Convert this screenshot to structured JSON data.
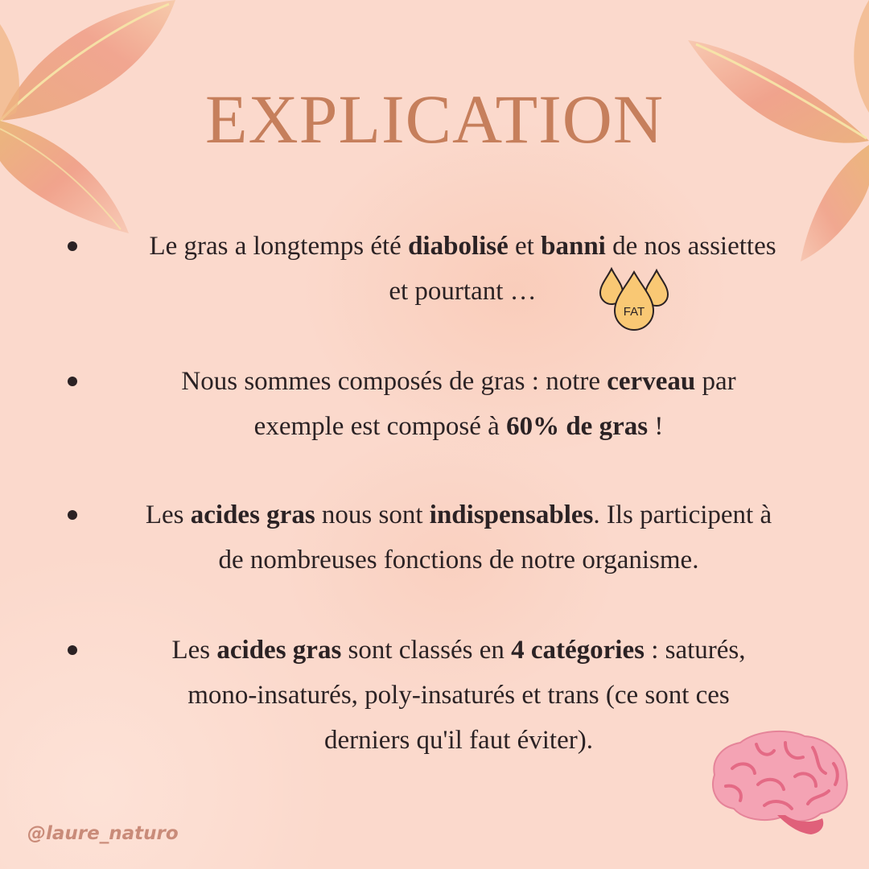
{
  "title": "EXPLICATION",
  "bullets": [
    {
      "lines": [
        [
          {
            "t": "Le gras a longtemps été ",
            "b": false
          },
          {
            "t": "diabolisé",
            "b": true
          },
          {
            "t": " et ",
            "b": false
          },
          {
            "t": "banni",
            "b": true
          },
          {
            "t": " de nos assiettes",
            "b": false
          }
        ],
        [
          {
            "t": "et pourtant …",
            "b": false
          }
        ]
      ]
    },
    {
      "lines": [
        [
          {
            "t": "Nous sommes composés de gras : notre ",
            "b": false
          },
          {
            "t": "cerveau",
            "b": true
          },
          {
            "t": " par",
            "b": false
          }
        ],
        [
          {
            "t": "exemple est composé à ",
            "b": false
          },
          {
            "t": "60% de gras",
            "b": true
          },
          {
            "t": " !",
            "b": false
          }
        ]
      ]
    },
    {
      "lines": [
        [
          {
            "t": "Les ",
            "b": false
          },
          {
            "t": "acides gras",
            "b": true
          },
          {
            "t": " nous sont ",
            "b": false
          },
          {
            "t": "indispensables",
            "b": true
          },
          {
            "t": ". Ils participent à",
            "b": false
          }
        ],
        [
          {
            "t": "de nombreuses fonctions de notre organisme.",
            "b": false
          }
        ]
      ]
    },
    {
      "lines": [
        [
          {
            "t": "Les ",
            "b": false
          },
          {
            "t": "acides gras",
            "b": true
          },
          {
            "t": " sont classés en ",
            "b": false
          },
          {
            "t": "4 catégories",
            "b": true
          },
          {
            "t": " : saturés,",
            "b": false
          }
        ],
        [
          {
            "t": "mono-insaturés, poly-insaturés et trans (ce sont ces",
            "b": false
          }
        ],
        [
          {
            "t": "derniers qu'il faut éviter).",
            "b": false
          }
        ]
      ]
    }
  ],
  "fat_icon": {
    "label": "FAT",
    "icon": "fat-drops-icon",
    "color": "#f9c874"
  },
  "brain_icon": {
    "icon": "brain-icon",
    "color": "#f08fa3"
  },
  "handle": "@laure_naturo",
  "colors": {
    "background": "#fbd9cc",
    "title": "#c67f5c",
    "text": "#2b2224",
    "handle": "#c98b79",
    "leaf": "#ef9f86"
  }
}
